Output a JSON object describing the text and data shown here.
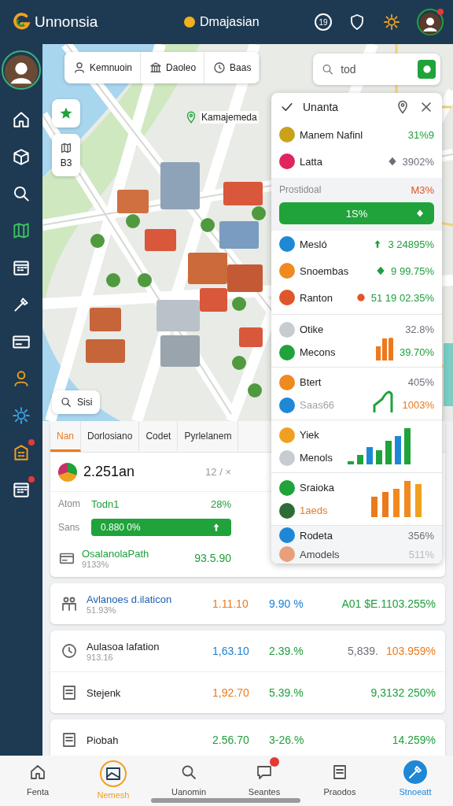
{
  "header": {
    "logo": "Unnonsia",
    "title": "Dmajasian",
    "icons": [
      {
        "kind": "count",
        "label": "19",
        "badge": false
      },
      {
        "kind": "shield",
        "badge": false
      },
      {
        "kind": "gear",
        "badge": false
      },
      {
        "kind": "avatar",
        "badge": true
      }
    ]
  },
  "sidebar": {
    "items": [
      {
        "kind": "avatar",
        "badge": false
      },
      {
        "kind": "home",
        "badge": false
      },
      {
        "kind": "box",
        "badge": false
      },
      {
        "kind": "search",
        "badge": false
      },
      {
        "kind": "map",
        "badge": false
      },
      {
        "kind": "calendar",
        "badge": false
      },
      {
        "kind": "tool",
        "badge": false
      },
      {
        "kind": "card",
        "badge": false
      },
      {
        "kind": "person",
        "badge": false
      },
      {
        "kind": "gear",
        "badge": false
      },
      {
        "kind": "building",
        "badge": true
      },
      {
        "kind": "calendar",
        "badge": true
      }
    ]
  },
  "map": {
    "chips": [
      {
        "label": "Kemnuoin",
        "kind": "person"
      },
      {
        "label": "Daoleo",
        "kind": "bank"
      },
      {
        "label": "Baas",
        "kind": "clock"
      }
    ],
    "search": {
      "value": "tod"
    },
    "place": "Kamajemeda",
    "zoom_label": "B3",
    "find": "Sisi"
  },
  "panel": {
    "title": "Unanta",
    "top_rows": [
      {
        "kind": "plain",
        "name": {
          "text": "Manem Nafinl",
          "color": "#222222"
        },
        "value": {
          "text": "31%9",
          "color": "#1f9e3a"
        },
        "color": "#c9a21a"
      },
      {
        "kind": "diamond",
        "name": {
          "text": "Latta",
          "color": "#222222"
        },
        "value": {
          "text": "3902%",
          "color": "#6b7078"
        },
        "color": "#e0245e"
      }
    ],
    "section": {
      "label": "Prostidoal",
      "reading": "M3%",
      "button": "1S%"
    },
    "mid_rows": [
      {
        "kind": "up",
        "name": {
          "text": "Mesló",
          "color": "#222222"
        },
        "value": {
          "text": "3 24895%",
          "color": "#1f9e3a"
        },
        "color": "#1e88d6"
      },
      {
        "kind": "diamond",
        "name": {
          "text": "Snoembas",
          "color": "#222222"
        },
        "value": {
          "text": "9 99.75%",
          "color": "#1f9e3a"
        },
        "color": "#f0891f"
      },
      {
        "kind": "dot",
        "name": {
          "text": "Ranton",
          "color": "#222222"
        },
        "value": {
          "text": "51 19 02.35%",
          "color": "#1f9e3a"
        },
        "color": "#e0552a"
      }
    ],
    "groups": [
      {
        "kind": "orange_bars",
        "rows": [
          {
            "name": {
              "text": "Otike",
              "color": "#222222"
            },
            "value": {
              "text": "32.8%",
              "color": "#6b7078"
            },
            "color": "#c8ccd2"
          },
          {
            "name": {
              "text": "Mecons",
              "color": "#222222"
            },
            "value": {
              "text": "39.70%",
              "color": "#1f9e3a"
            },
            "color": "#1fa33a"
          }
        ]
      },
      {
        "kind": "green_line",
        "rows": [
          {
            "name": {
              "text": "Btert",
              "color": "#222222"
            },
            "value": {
              "text": "405%",
              "color": "#6b7078"
            },
            "color": "#f0891f"
          },
          {
            "name": {
              "text": "Saas66",
              "color": "#a0a4aa"
            },
            "value": {
              "text": "1003%",
              "color": "#ec7a1c"
            },
            "color": "#1e88d6"
          }
        ]
      },
      {
        "kind": "mixed_bars",
        "rows": [
          {
            "name": {
              "text": "Yiek",
              "color": "#222222"
            },
            "color": "#f0a020"
          },
          {
            "name": {
              "text": "Menols",
              "color": "#222222"
            },
            "color": "#c8ccd2"
          }
        ]
      },
      {
        "kind": "tall_orange_bars",
        "rows": [
          {
            "name": {
              "text": "Sraioka",
              "color": "#222222"
            },
            "color": "#1fa33a"
          },
          {
            "name": {
              "text": "1aeds",
              "color": "#ec7a1c"
            },
            "color": "#2e6b35"
          }
        ]
      }
    ],
    "footer_rows": [
      {
        "name": {
          "text": "Rodeta",
          "color": "#222222"
        },
        "value": {
          "text": "356%",
          "color": "#6b7078"
        },
        "color": "#1e88d6"
      },
      {
        "name": {
          "text": "Amodels",
          "color": "#444444"
        },
        "value": {
          "text": "511%",
          "color": "#b9bcc2"
        },
        "color": "#e8a07a"
      }
    ]
  },
  "lower": {
    "tabs": [
      {
        "label": "Nan",
        "selected": true
      },
      {
        "label": "Dorlosiano",
        "selected": false
      },
      {
        "label": "Codet",
        "selected": false
      },
      {
        "label": "Pyrlelanem",
        "selected": false
      }
    ],
    "summary": {
      "amount": "2.251an",
      "meta": "12 / ×"
    },
    "stat": {
      "label": "Atom",
      "name": "Todn1",
      "value": "28%"
    },
    "progress": {
      "label": "Sans",
      "reading": "0.880 0%",
      "level": 1
    },
    "path": {
      "name": "OsalanolaPath",
      "sub": "9133%",
      "value": "93.5.90"
    }
  },
  "cards": [
    {
      "rows": [
        {
          "kind": "people",
          "name": {
            "text": "Avlanoes d.ilaticon",
            "color": "#1e5fb0"
          },
          "sub": "51.93%",
          "values": [
            {
              "text": "1.11.10",
              "color": "#ec7a1c"
            },
            {
              "text": "9.90 %",
              "color": "#1e7fd0"
            },
            {
              "text": "A01 $E.1103.255%",
              "color": "#1f9e3a"
            }
          ]
        }
      ]
    },
    {
      "rows": [
        {
          "kind": "clock",
          "name": {
            "text": "Aulasoa lafation",
            "color": "#222222"
          },
          "sub": "913.16",
          "values": [
            {
              "text": "1,63.10",
              "color": "#1e7fd0"
            },
            {
              "text": "2.39.%",
              "color": "#1f9e3a"
            },
            {
              "text": "5,839.",
              "color": "#6b7078"
            },
            {
              "text": "103.959%",
              "color": "#ec7a1c"
            }
          ]
        },
        {
          "kind": "doc",
          "name": {
            "text": "Stejenk",
            "color": "#222222"
          },
          "values": [
            {
              "text": "1,92.70",
              "color": "#ec7a1c"
            },
            {
              "text": "5.39.%",
              "color": "#1f9e3a"
            },
            {
              "text": "9,3132 250%",
              "color": "#1f9e3a"
            }
          ]
        }
      ]
    },
    {
      "rows": [
        {
          "kind": "doc",
          "name": {
            "text": "Piobah",
            "color": "#222222"
          },
          "values": [
            {
              "text": "2.56.70",
              "color": "#1f9e3a"
            },
            {
              "text": "3-26.%",
              "color": "#1f9e3a"
            },
            {
              "text": "14.259%",
              "color": "#1f9e3a"
            }
          ]
        }
      ]
    }
  ],
  "nav": {
    "items": [
      {
        "label": "Fenta",
        "kind": "home",
        "selected": false,
        "badge": false
      },
      {
        "label": "Nemesh",
        "kind": "image",
        "selected": true,
        "badge": false
      },
      {
        "label": "Uanomin",
        "kind": "search",
        "selected": false,
        "badge": false
      },
      {
        "label": "Seantes",
        "kind": "chat",
        "selected": false,
        "badge": true
      },
      {
        "label": "Praodos",
        "kind": "doc",
        "selected": false,
        "badge": false
      },
      {
        "label": "Stnoeatt",
        "kind": "tool",
        "selected": false,
        "badge": false
      }
    ]
  }
}
